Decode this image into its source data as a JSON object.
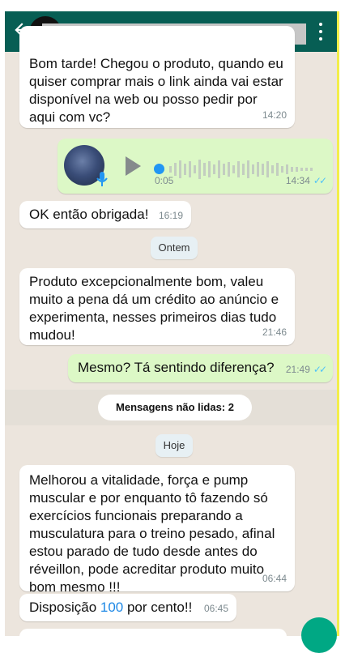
{
  "messages": {
    "m1": {
      "text": "Bom tarde! Chegou o produto, quando eu quiser comprar mais o link ainda vai estar disponível na web ou posso pedir por aqui com vc?",
      "time": "14:20"
    },
    "voice": {
      "duration": "0:05",
      "time": "14:34",
      "ticks": "✓✓"
    },
    "m2": {
      "text": "OK então obrigada!",
      "time": "16:19"
    },
    "m3": {
      "text": "Produto excepcionalmente bom, valeu muito a pena dá um crédito ao anúncio e experimenta, nesses primeiros dias tudo mudou!",
      "time": "21:46"
    },
    "m4": {
      "text": "Mesmo? Tá sentindo diferença?",
      "time": "21:49",
      "ticks": "✓✓"
    },
    "m5": {
      "text": "Melhorou a vitalidade, força e pump muscular e por enquanto tô fazendo só exercícios funcionais preparando a musculatura para o treino pesado, afinal estou parado de tudo desde antes do réveillon, pode acreditar produto muito bom mesmo !!!",
      "time": "06:44"
    },
    "m6": {
      "text_before": "Disposição ",
      "number": "100",
      "text_after": " por cento!!",
      "time": "06:45"
    }
  },
  "dates": {
    "ontem": "Ontem",
    "hoje": "Hoje"
  },
  "unread_label": "Mensagens não lidas: 2",
  "colors": {
    "header": "#075e54",
    "outgoing": "#dcf8c6",
    "incoming": "#ffffff",
    "background": "#ece5dd",
    "ticks": "#4fc3f7",
    "link_number": "#1e88e5"
  }
}
